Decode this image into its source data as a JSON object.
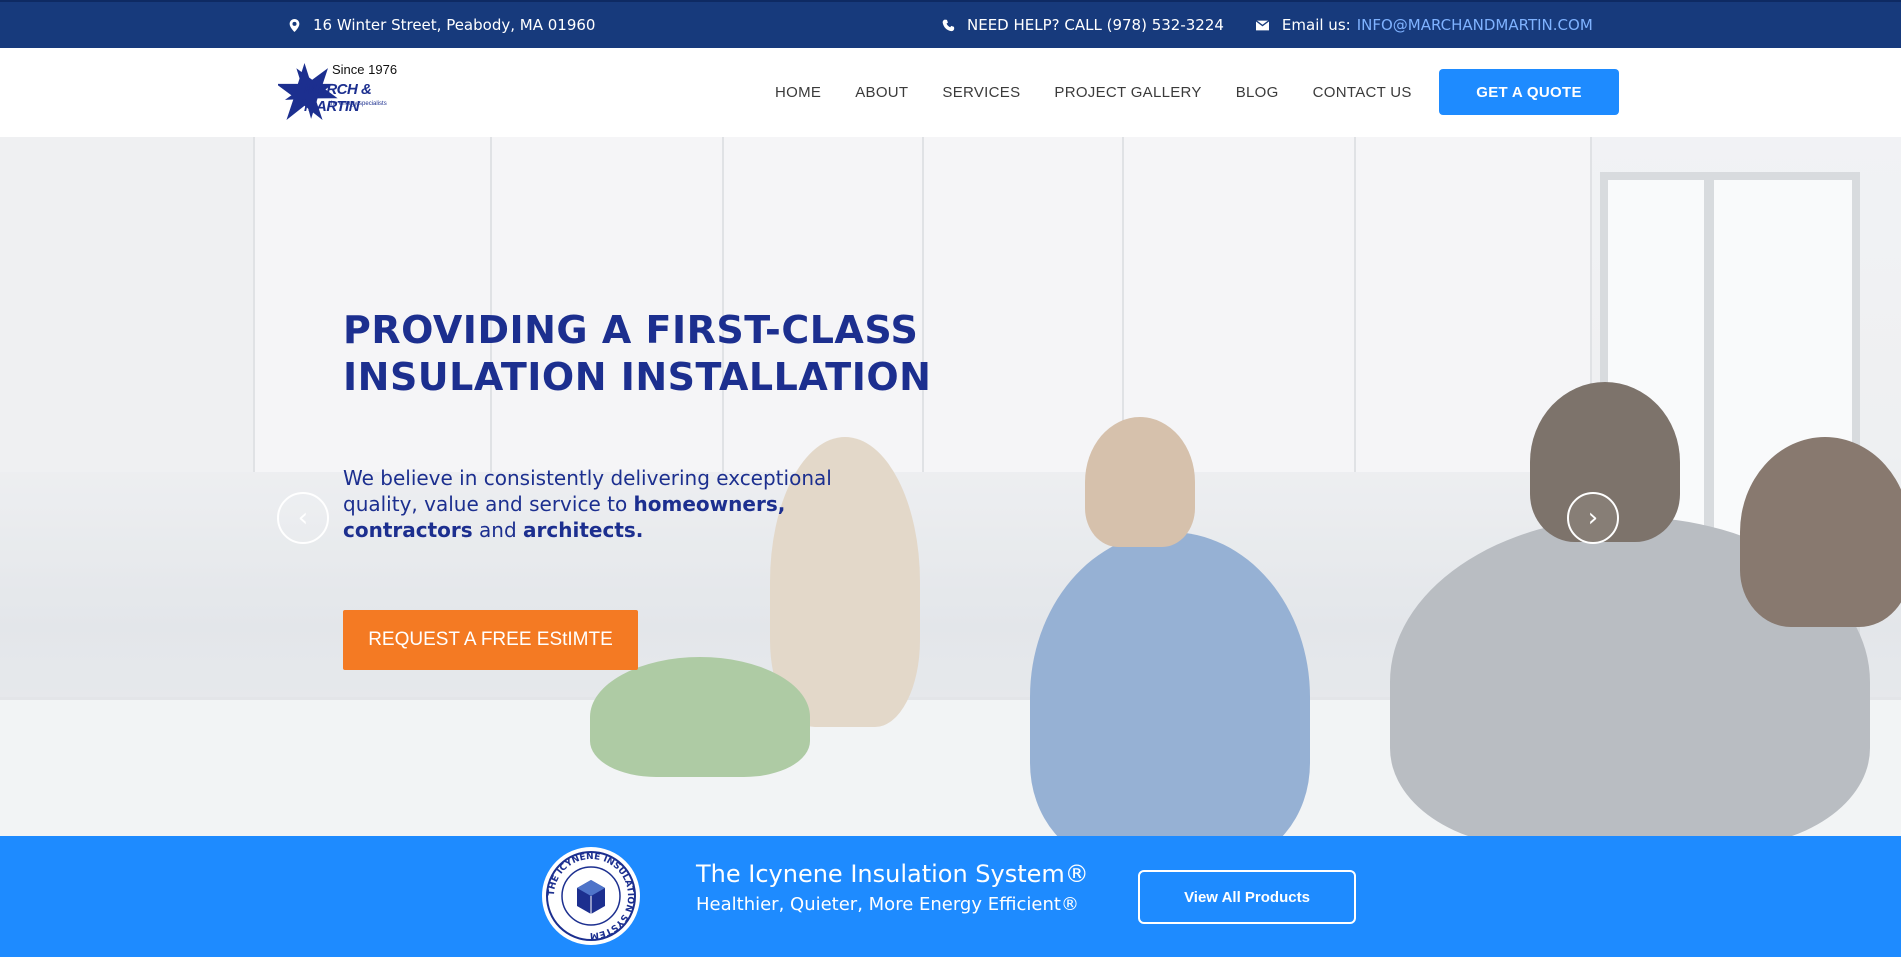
{
  "topbar": {
    "address": "16 Winter Street, Peabody, MA 01960",
    "phone_text": "NEED HELP? CALL (978) 532-3224",
    "email_label": "Email us:",
    "email": "INFO@MARCHANDMARTIN.COM",
    "icons": [
      "map-pin-icon",
      "phone-icon",
      "envelope-icon"
    ]
  },
  "logo": {
    "since": "Since 1976",
    "brand": "MARCH & MARTIN",
    "tagline": "the energy specialists"
  },
  "nav": {
    "items": [
      "HOME",
      "ABOUT",
      "SERVICES",
      "PROJECT GALLERY",
      "BLOG",
      "CONTACT US"
    ],
    "cta": "GET A QUOTE"
  },
  "hero": {
    "title_line1": "PROVIDING A FIRST-CLASS",
    "title_line2": "INSULATION INSTALLATION",
    "sub_1": "We believe in consistently delivering exceptional quality, value and service to ",
    "sub_b1": "homeowners,",
    "sub_2": " ",
    "sub_b2": "contractors",
    "sub_3": " and ",
    "sub_b3": "architects.",
    "cta": "REQUEST A FREE EStIMTE",
    "prev_arrow": "‹",
    "next_arrow": "›"
  },
  "product": {
    "seal_text": "THE ICYNENE INSULATION SYSTEM",
    "title": "The Icynene Insulation System®",
    "subtitle": "Healthier, Quieter, More Energy Efficient®",
    "button": "View All Products"
  },
  "colors": {
    "topbar": "#173a7c",
    "accent_blue": "#1e8bff",
    "navy_text": "#1c2f8f",
    "orange": "#f47a23",
    "email_link": "#7fb2ff"
  }
}
